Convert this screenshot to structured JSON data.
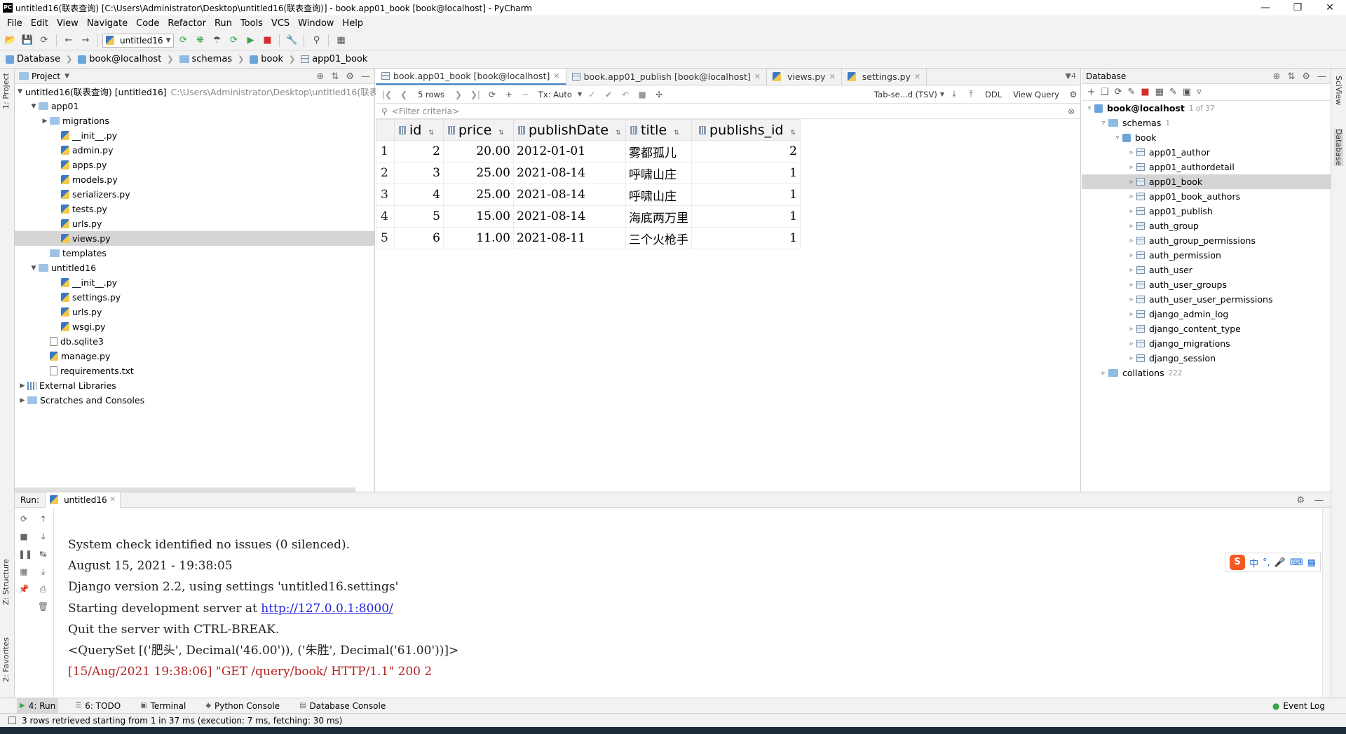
{
  "window": {
    "title": "untitled16(联表查询) [C:\\Users\\Administrator\\Desktop\\untitled16(联表查询)] - book.app01_book [book@localhost] - PyCharm",
    "logo": "PC"
  },
  "menu": [
    "File",
    "Edit",
    "View",
    "Navigate",
    "Code",
    "Refactor",
    "Run",
    "Tools",
    "VCS",
    "Window",
    "Help"
  ],
  "toolbar": {
    "run_config": "untitled16"
  },
  "breadcrumb": [
    "Database",
    "book@localhost",
    "schemas",
    "book",
    "app01_book"
  ],
  "project": {
    "header": "Project",
    "tree": [
      {
        "label": "untitled16(联表查询) [untitled16]",
        "path": "C:\\Users\\Administrator\\Desktop\\untitled16(联表",
        "depth": 0,
        "arrow": "down",
        "icon": "dir"
      },
      {
        "label": "app01",
        "depth": 1,
        "arrow": "down",
        "icon": "dir"
      },
      {
        "label": "migrations",
        "depth": 2,
        "arrow": "right",
        "icon": "dir"
      },
      {
        "label": "__init__.py",
        "depth": 3,
        "icon": "py"
      },
      {
        "label": "admin.py",
        "depth": 3,
        "icon": "py"
      },
      {
        "label": "apps.py",
        "depth": 3,
        "icon": "py"
      },
      {
        "label": "models.py",
        "depth": 3,
        "icon": "py"
      },
      {
        "label": "serializers.py",
        "depth": 3,
        "icon": "py"
      },
      {
        "label": "tests.py",
        "depth": 3,
        "icon": "py"
      },
      {
        "label": "urls.py",
        "depth": 3,
        "icon": "py"
      },
      {
        "label": "views.py",
        "depth": 3,
        "icon": "py",
        "selected": true
      },
      {
        "label": "templates",
        "depth": 2,
        "icon": "dir"
      },
      {
        "label": "untitled16",
        "depth": 1,
        "arrow": "down",
        "icon": "dir"
      },
      {
        "label": "__init__.py",
        "depth": 3,
        "icon": "py"
      },
      {
        "label": "settings.py",
        "depth": 3,
        "icon": "py"
      },
      {
        "label": "urls.py",
        "depth": 3,
        "icon": "py"
      },
      {
        "label": "wsgi.py",
        "depth": 3,
        "icon": "py"
      },
      {
        "label": "db.sqlite3",
        "depth": 2,
        "icon": "txt"
      },
      {
        "label": "manage.py",
        "depth": 2,
        "icon": "py"
      },
      {
        "label": "requirements.txt",
        "depth": 2,
        "icon": "txt"
      },
      {
        "label": "External Libraries",
        "depth": 0,
        "arrow": "right",
        "icon": "lib"
      },
      {
        "label": "Scratches and Consoles",
        "depth": 0,
        "arrow": "right",
        "icon": "dir"
      }
    ]
  },
  "editor": {
    "tabs": [
      {
        "label": "book.app01_book [book@localhost]",
        "active": true
      },
      {
        "label": "book.app01_publish [book@localhost]"
      },
      {
        "label": "views.py"
      },
      {
        "label": "settings.py"
      }
    ],
    "tab_count": "4",
    "grid_toolbar": {
      "rows": "5 rows",
      "tx": "Tx: Auto",
      "format": "Tab-se...d (TSV)",
      "ddl": "DDL",
      "view_query": "View Query"
    },
    "filter_placeholder": "<Filter criteria>",
    "columns": [
      "id",
      "price",
      "publishDate",
      "title",
      "publishs_id"
    ],
    "rows": [
      [
        "1",
        "2",
        "20.00",
        "2012-01-01",
        "雾都孤儿",
        "2"
      ],
      [
        "2",
        "3",
        "25.00",
        "2021-08-14",
        "呼啸山庄",
        "1"
      ],
      [
        "3",
        "4",
        "25.00",
        "2021-08-14",
        "呼啸山庄",
        "1"
      ],
      [
        "4",
        "5",
        "15.00",
        "2021-08-14",
        "海底两万里",
        "1"
      ],
      [
        "5",
        "6",
        "11.00",
        "2021-08-11",
        "三个火枪手",
        "1"
      ]
    ]
  },
  "database": {
    "header": "Database",
    "root": {
      "label": "book@localhost",
      "count": "1 of 37"
    },
    "schemas": {
      "label": "schemas",
      "count": "1"
    },
    "schema": "book",
    "tables": [
      "app01_author",
      "app01_authordetail",
      "app01_book",
      "app01_book_authors",
      "app01_publish",
      "auth_group",
      "auth_group_permissions",
      "auth_permission",
      "auth_user",
      "auth_user_groups",
      "auth_user_user_permissions",
      "django_admin_log",
      "django_content_type",
      "django_migrations",
      "django_session"
    ],
    "selected_table": "app01_book",
    "collations": {
      "label": "collations",
      "count": "222"
    }
  },
  "run": {
    "label": "Run:",
    "tab": "untitled16",
    "lines": [
      "System check identified no issues (0 silenced).",
      "August 15, 2021 - 19:38:05",
      "Django version 2.2, using settings 'untitled16.settings'",
      "Starting development server at ",
      "Quit the server with CTRL-BREAK.",
      "<QuerySet [('肥头', Decimal('46.00')), ('朱胜', Decimal('61.00'))]>",
      "[15/Aug/2021 19:38:06] \"GET /query/book/ HTTP/1.1\" 200 2"
    ],
    "url": "http://127.0.0.1:8000/",
    "ime": [
      "中",
      "°,"
    ]
  },
  "side_tabs": {
    "project": "1: Project",
    "structure": "Z: Structure",
    "favorites": "2: Favorites",
    "sciview": "SciView",
    "database": "Database"
  },
  "tool_tabs": [
    "4: Run",
    "6: TODO",
    "Terminal",
    "Python Console",
    "Database Console"
  ],
  "event_log": "Event Log",
  "status": "3 rows retrieved starting from 1 in 37 ms (execution: 7 ms, fetching: 30 ms)"
}
